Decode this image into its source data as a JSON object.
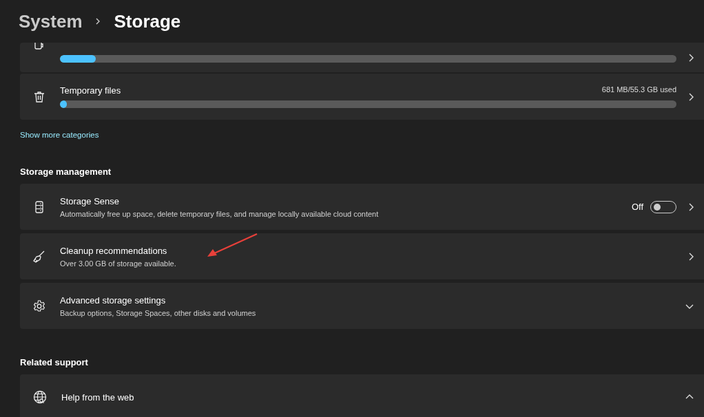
{
  "breadcrumb": [
    "System",
    "Storage"
  ],
  "categories": [
    {
      "level": 0.058
    },
    {
      "name": "Temporary files",
      "usage": "681 MB/55.3 GB used",
      "level": 0.007
    }
  ],
  "show_more_link": "Show more categories",
  "storage_management": {
    "heading": "Storage management",
    "items": [
      {
        "kind": "toggle",
        "title": "Storage Sense",
        "subtitle": "Automatically free up space, delete temporary files, and manage locally available cloud content",
        "toggle_label": "Off",
        "on": false
      },
      {
        "kind": "link",
        "title": "Cleanup recommendations",
        "subtitle": "Over 3.00 GB of storage available."
      },
      {
        "kind": "expander",
        "title": "Advanced storage settings",
        "subtitle": "Backup options, Storage Spaces, other disks and volumes",
        "expanded": false
      }
    ]
  },
  "related_support": {
    "heading": "Related support",
    "items": [
      {
        "kind": "expander",
        "title": "Help from the web",
        "expanded": true
      }
    ]
  }
}
